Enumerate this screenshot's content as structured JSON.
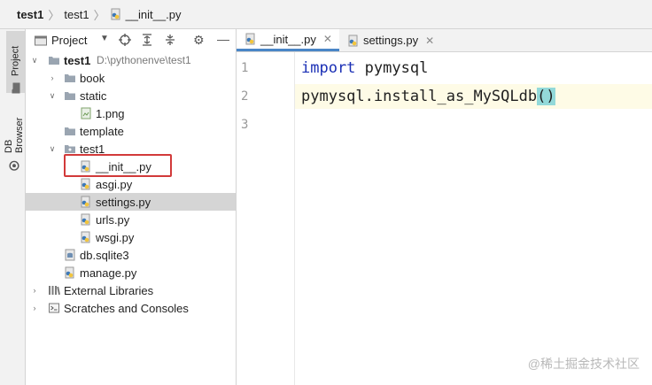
{
  "breadcrumb": [
    "test1",
    "test1",
    "__init__.py"
  ],
  "sidebar_tabs": [
    "Project",
    "DB Browser"
  ],
  "project_panel": {
    "title": "Project"
  },
  "tree": [
    {
      "label": "test1",
      "hint": "D:\\pythonenve\\test1",
      "type": "folder",
      "depth": 0,
      "expanded": true,
      "bold": true
    },
    {
      "label": "book",
      "type": "folder",
      "depth": 1,
      "expanded": false
    },
    {
      "label": "static",
      "type": "folder",
      "depth": 1,
      "expanded": true
    },
    {
      "label": "1.png",
      "type": "image",
      "depth": 2
    },
    {
      "label": "template",
      "type": "folder",
      "depth": 1,
      "leaf": true
    },
    {
      "label": "test1",
      "type": "folder",
      "depth": 1,
      "expanded": true
    },
    {
      "label": "__init__.py",
      "type": "python",
      "depth": 2,
      "highlighted": true
    },
    {
      "label": "asgi.py",
      "type": "python",
      "depth": 2
    },
    {
      "label": "settings.py",
      "type": "python",
      "depth": 2,
      "selected": true
    },
    {
      "label": "urls.py",
      "type": "python",
      "depth": 2
    },
    {
      "label": "wsgi.py",
      "type": "python",
      "depth": 2
    },
    {
      "label": "db.sqlite3",
      "type": "db",
      "depth": 1
    },
    {
      "label": "manage.py",
      "type": "python",
      "depth": 1
    },
    {
      "label": "External Libraries",
      "type": "library",
      "depth": 0,
      "expanded": false
    },
    {
      "label": "Scratches and Consoles",
      "type": "scratches",
      "depth": 0,
      "expanded": false
    }
  ],
  "editor_tabs": [
    {
      "label": "__init__.py",
      "active": true
    },
    {
      "label": "settings.py",
      "active": false
    }
  ],
  "code": {
    "line_numbers": [
      "1",
      "2",
      "3"
    ],
    "line1": {
      "keyword": "import",
      "rest": " pymysql"
    },
    "line2": {
      "text": "pymysql.install_as_MySQLdb",
      "paren": "()"
    }
  },
  "watermark": "@稀土掘金技术社区",
  "colors": {
    "keyword": "#1a2fb5",
    "highlight_box": "#d23a3a",
    "bracket_match": "#93d9d9"
  }
}
